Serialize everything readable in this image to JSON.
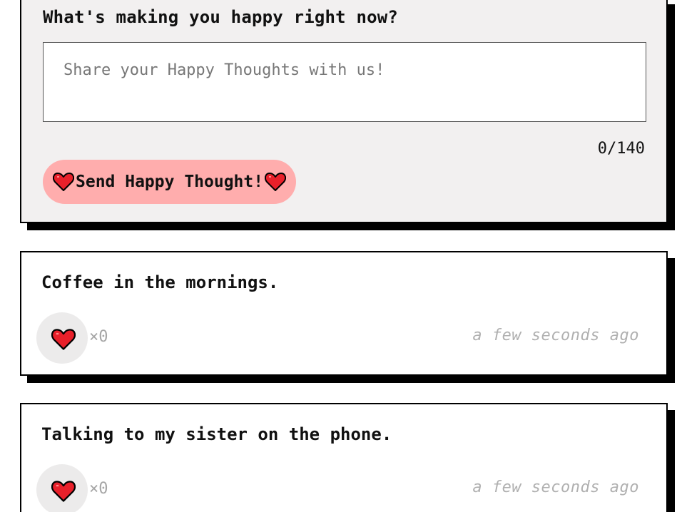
{
  "form": {
    "title": "What's making you happy right now?",
    "input_value": "",
    "input_placeholder": "Share your Happy Thoughts with us!",
    "char_count": "0/140",
    "send_label": "Send Happy Thought!",
    "send_color": "#ffadad",
    "background": "#f2f0f0"
  },
  "thoughts": [
    {
      "message": "Coffee in the mornings.",
      "likes": "×0",
      "timestamp": "a few seconds ago"
    },
    {
      "message": "Talking to my sister on the phone.",
      "likes": "×0",
      "timestamp": "a few seconds ago"
    }
  ],
  "icons": {
    "heart": "heart-icon",
    "heart_color": "#e8202a"
  }
}
